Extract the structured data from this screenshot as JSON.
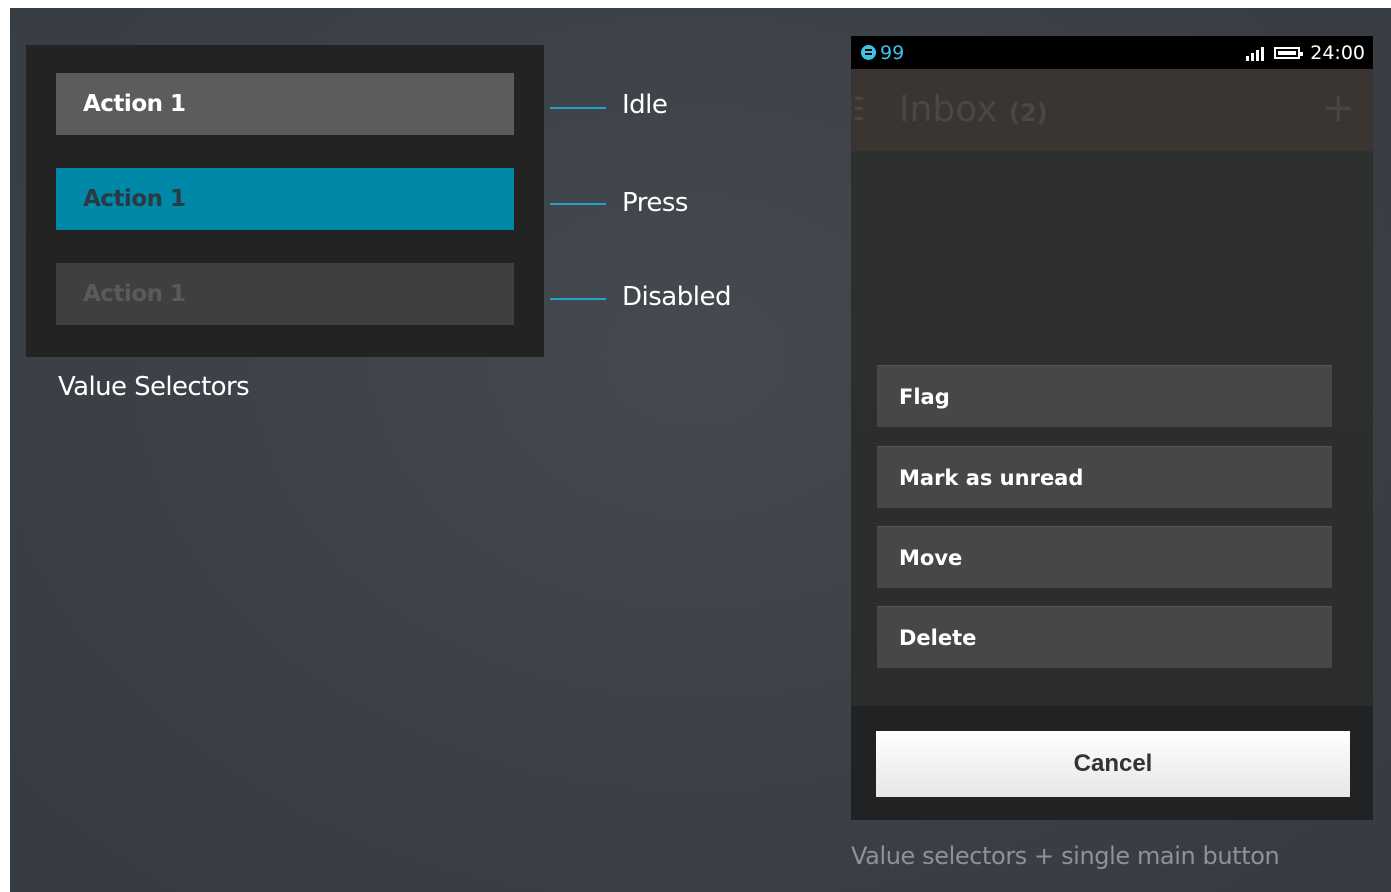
{
  "left": {
    "buttons": {
      "idle_label": "Action 1",
      "press_label": "Action 1",
      "disabled_label": "Action 1"
    },
    "states": {
      "idle": "Idle",
      "press": "Press",
      "disabled": "Disabled"
    },
    "caption": "Value Selectors"
  },
  "phone": {
    "status": {
      "notification_count": "99",
      "time": "24:00"
    },
    "appbar": {
      "title": "Inbox",
      "count": "(2)"
    },
    "menu": [
      "Flag",
      "Mark as unread",
      "Move",
      "Delete"
    ],
    "cancel_label": "Cancel",
    "caption": "Value selectors + single main button"
  },
  "colors": {
    "accent": "#0088a9",
    "connector": "#22a2c4",
    "idle_button": "#5c5c5c",
    "disabled_button": "#3f3f3f"
  }
}
